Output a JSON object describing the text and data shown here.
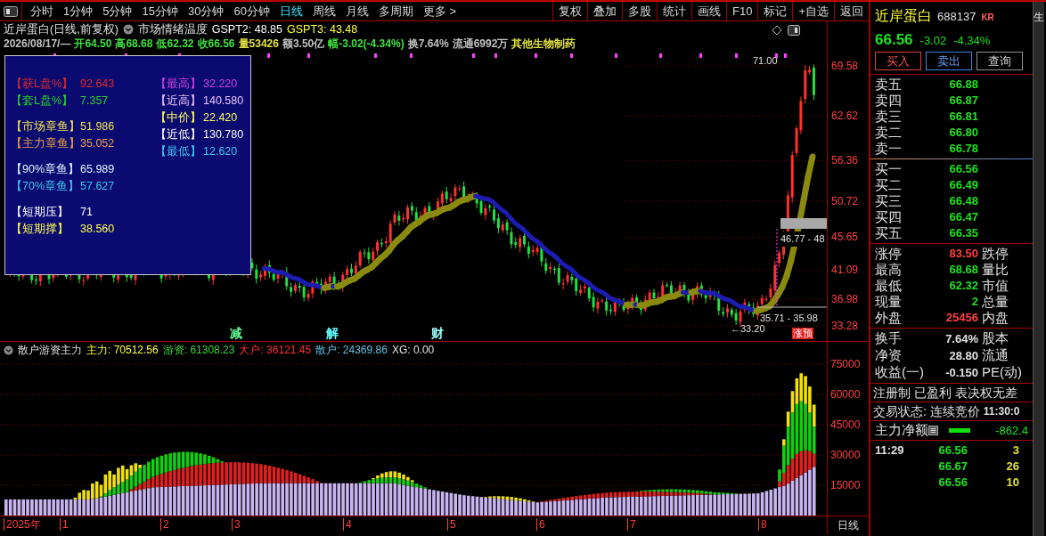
{
  "toolbar": {
    "periods": [
      {
        "label": "分时",
        "selected": false
      },
      {
        "label": "1分钟",
        "selected": false
      },
      {
        "label": "5分钟",
        "selected": false
      },
      {
        "label": "15分钟",
        "selected": false
      },
      {
        "label": "30分钟",
        "selected": false
      },
      {
        "label": "60分钟",
        "selected": false
      },
      {
        "label": "日线",
        "selected": true
      },
      {
        "label": "周线",
        "selected": false
      },
      {
        "label": "月线",
        "selected": false
      },
      {
        "label": "多周期",
        "selected": false
      },
      {
        "label": "更多 >",
        "selected": false
      }
    ],
    "buttons": [
      "复权",
      "叠加",
      "多股",
      "统计",
      "画线",
      "F10",
      "标记",
      "+自选",
      "返回"
    ]
  },
  "chart_header": {
    "title": "近岸蛋白(日线,前复权)",
    "indicator": "市场情绪温度",
    "values": [
      {
        "text": "GSPT2: 48.85",
        "color": "#ffffff"
      },
      {
        "text": "GSPT3: 43.48",
        "color": "#ffff40"
      }
    ]
  },
  "quote_line": [
    {
      "text": "2026/08/17/—",
      "color": "#c0c0c0"
    },
    {
      "text": "开64.50",
      "color": "#40e040"
    },
    {
      "text": "高68.68",
      "color": "#40e040"
    },
    {
      "text": "低62.32",
      "color": "#40e040"
    },
    {
      "text": "收66.56",
      "color": "#40e040"
    },
    {
      "text": "量53426",
      "color": "#e0e040"
    },
    {
      "text": "额3.50亿",
      "color": "#c0c0c0"
    },
    {
      "text": "幅-3.02(-4.34%)",
      "color": "#40e040"
    },
    {
      "text": "换7.64%",
      "color": "#c0c0c0"
    },
    {
      "text": "流通6992万",
      "color": "#c0c0c0"
    },
    {
      "text": "其他生物制药",
      "color": "#e0e040"
    }
  ],
  "overlay_panel": {
    "left_groups": [
      [
        {
          "label": "【获L盘%】",
          "value": "92.643",
          "color": "#e02828"
        },
        {
          "label": "【套L盘%】",
          "value": "7.357",
          "color": "#28d028"
        }
      ],
      [
        {
          "label": "【市场章鱼】",
          "value": "51.986",
          "color": "#f0e050"
        },
        {
          "label": "【主力章鱼】",
          "value": "35.052",
          "color": "#f0a040"
        }
      ],
      [
        {
          "label": "【90%章鱼】",
          "value": "65.989",
          "color": "#e0f8ff"
        },
        {
          "label": "【70%章鱼】",
          "value": "57.627",
          "color": "#40c8f0"
        }
      ],
      [
        {
          "label": "【短期压】",
          "value": "71",
          "color": "#ffffff"
        },
        {
          "label": "【短期撑】",
          "value": "38.560",
          "color": "#ffff50"
        }
      ]
    ],
    "right": [
      {
        "label": "【最高】",
        "value": "32.220",
        "color": "#d040e0"
      },
      {
        "label": "【近高】",
        "value": "140.580",
        "color": "#e8c0f8"
      },
      {
        "label": "【中价】",
        "value": "22.420",
        "color": "#ffff60"
      },
      {
        "label": "【近低】",
        "value": "130.780",
        "color": "#ffffff"
      },
      {
        "label": "【最低】",
        "value": "12.620",
        "color": "#40c8f0"
      }
    ]
  },
  "price_axis": [
    "69.58",
    "62.62",
    "56.36",
    "50.72",
    "45.65",
    "41.09",
    "36.98",
    "33.28"
  ],
  "annotations": {
    "high": "71.00",
    "range_upper": "46.77 - 48",
    "range_lower": "35.71 - 35.98",
    "low": "←33.20",
    "signal": "涨预"
  },
  "event_markers": [
    {
      "label": "减",
      "color": "#60ff90"
    },
    {
      "label": "解",
      "color": "#60ffff"
    },
    {
      "label": "财",
      "color": "#a0ffff"
    }
  ],
  "indicator": {
    "title": "散户游资主力",
    "values": [
      {
        "text": "主力: 70512.56",
        "color": "#ffff40"
      },
      {
        "text": "游资: 61308.23",
        "color": "#40d040"
      },
      {
        "text": "大户: 36121.45",
        "color": "#ff3030"
      },
      {
        "text": "散户: 24369.86",
        "color": "#60c0e0"
      },
      {
        "text": "XG: 0.00",
        "color": "#e0e0e0"
      }
    ],
    "axis": [
      "75000",
      "60000",
      "45000",
      "30000",
      "15000"
    ]
  },
  "time_axis": {
    "labels": [
      "2025年",
      "1",
      "2",
      "3",
      "4",
      "5",
      "6",
      "7",
      "8"
    ],
    "period": "日线"
  },
  "quote_panel": {
    "name": "近岸蛋白",
    "code": "688137",
    "badge": "KR",
    "price": "66.56",
    "change": "-3.02",
    "change_pct": "-4.34%",
    "actions": [
      "买入",
      "卖出",
      "查询"
    ],
    "sell": [
      {
        "label": "卖五",
        "price": "66.88"
      },
      {
        "label": "卖四",
        "price": "66.87"
      },
      {
        "label": "卖三",
        "price": "66.81"
      },
      {
        "label": "卖二",
        "price": "66.80"
      },
      {
        "label": "卖一",
        "price": "66.78"
      }
    ],
    "buy": [
      {
        "label": "买一",
        "price": "66.56"
      },
      {
        "label": "买二",
        "price": "66.49"
      },
      {
        "label": "买三",
        "price": "66.48"
      },
      {
        "label": "买四",
        "price": "66.47"
      },
      {
        "label": "买五",
        "price": "66.35"
      }
    ],
    "stats": [
      {
        "label": "涨停",
        "value": "83.50",
        "color": "#ff4040",
        "label2": "跌停"
      },
      {
        "label": "最高",
        "value": "68.68",
        "color": "#20e020",
        "label2": "量比"
      },
      {
        "label": "最低",
        "value": "62.32",
        "color": "#20e020",
        "label2": "市值"
      },
      {
        "label": "现量",
        "value": "2",
        "color": "#20e020",
        "label2": "总量"
      },
      {
        "label": "外盘",
        "value": "25456",
        "color": "#ff4040",
        "label2": "内盘"
      }
    ],
    "fundamentals": [
      {
        "label": "换手",
        "value": "7.64%",
        "label2": "股本"
      },
      {
        "label": "净资",
        "value": "28.80",
        "label2": "流通"
      },
      {
        "label": "收益(一)",
        "value": "-0.150",
        "label2": "PE(动)"
      }
    ],
    "tags": "注册制 已盈利 表决权无差",
    "trade_status": "交易状态: 连续竞价",
    "status_time": "11:30:0",
    "net_flow": {
      "label": "主力净额",
      "value": "-862.4"
    },
    "ticks": [
      {
        "time": "11:29",
        "price": "66.56",
        "volume": "3"
      },
      {
        "price": "66.67",
        "volume": "26"
      },
      {
        "price": "66.56",
        "volume": "10"
      }
    ]
  },
  "side_tab": "生"
}
